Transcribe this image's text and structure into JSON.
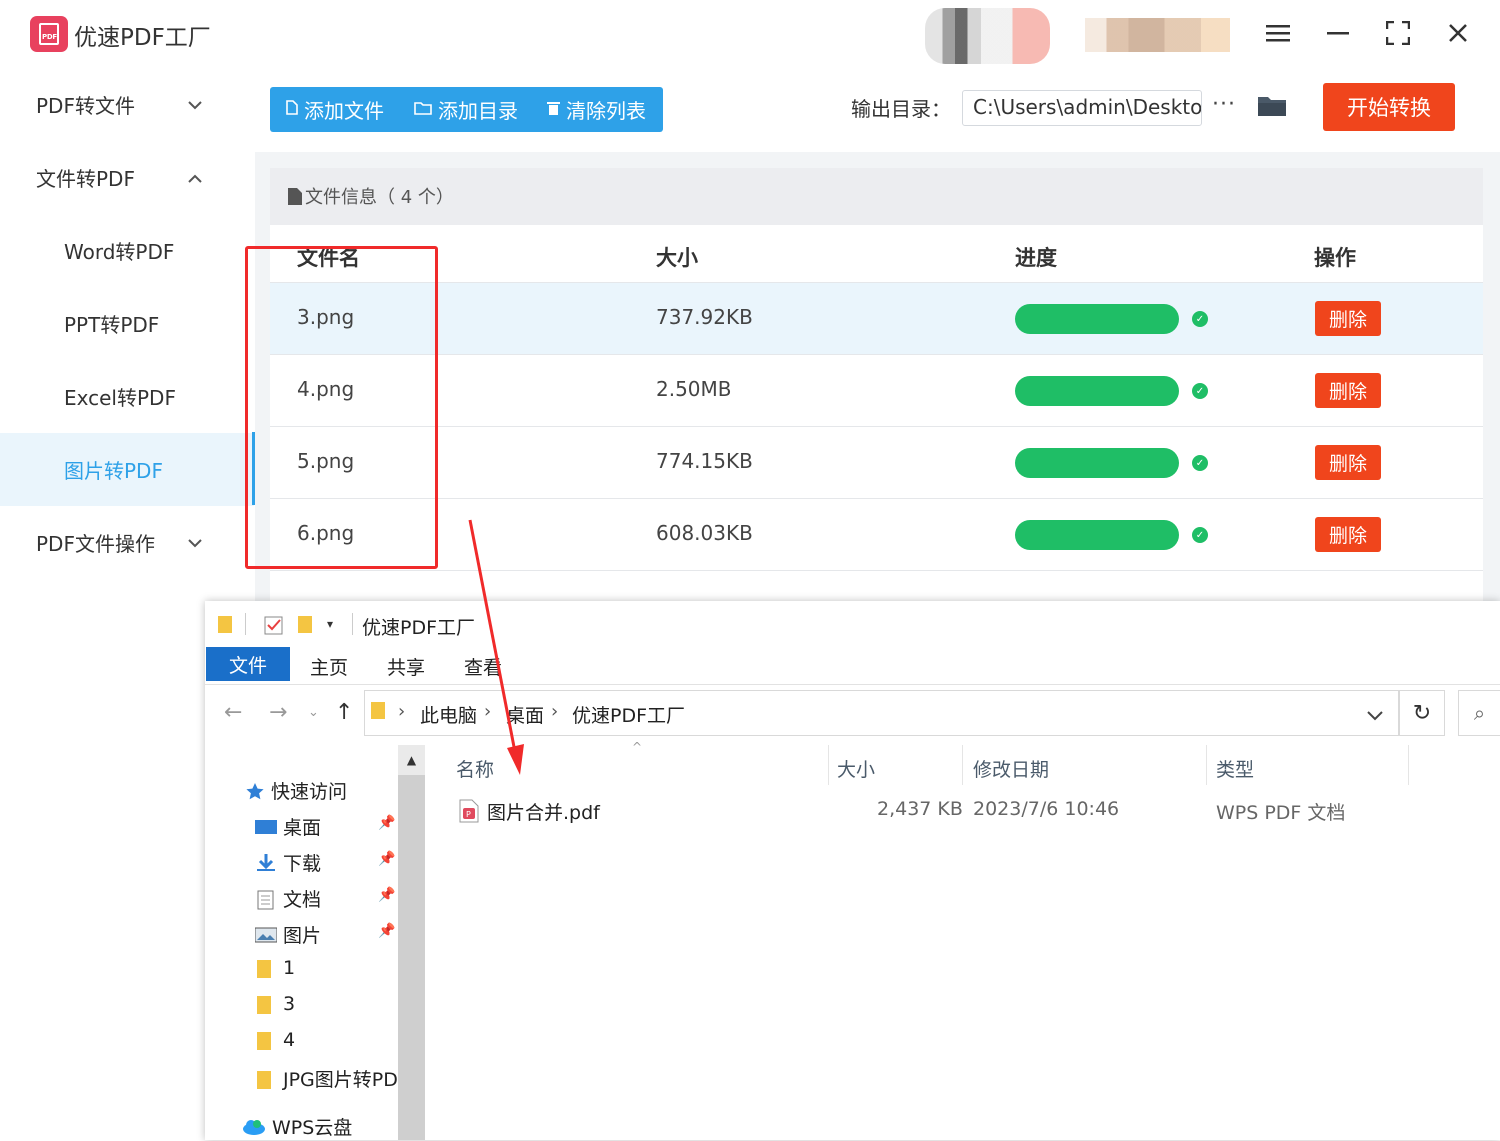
{
  "app": {
    "title": "优速PDF工厂",
    "logo_text": "PDF"
  },
  "window_controls": [
    "menu-icon",
    "minimize-icon",
    "fullscreen-icon",
    "close-icon"
  ],
  "sidebar": {
    "items": [
      {
        "label": "PDF转文件",
        "expanded": false
      },
      {
        "label": "文件转PDF",
        "expanded": true
      },
      {
        "label": "Word转PDF",
        "sub": true
      },
      {
        "label": "PPT转PDF",
        "sub": true
      },
      {
        "label": "Excel转PDF",
        "sub": true
      },
      {
        "label": "图片转PDF",
        "sub": true,
        "active": true
      },
      {
        "label": "PDF文件操作",
        "expanded": false
      }
    ]
  },
  "toolbar": {
    "add_file": "添加文件",
    "add_dir": "添加目录",
    "clear_list": "清除列表",
    "output_label": "输出目录：",
    "output_value": "C:\\Users\\admin\\Deskto",
    "more": "···",
    "start": "开始转换"
  },
  "file_panel": {
    "title": "文件信息（ 4 个）",
    "columns": [
      "文件名",
      "大小",
      "进度",
      "操作"
    ],
    "rows": [
      {
        "name": "3.png",
        "size": "737.92KB",
        "progress": 1.0,
        "action": "删除"
      },
      {
        "name": "4.png",
        "size": "2.50MB",
        "progress": 1.0,
        "action": "删除"
      },
      {
        "name": "5.png",
        "size": "774.15KB",
        "progress": 1.0,
        "action": "删除"
      },
      {
        "name": "6.png",
        "size": "608.03KB",
        "progress": 1.0,
        "action": "删除"
      }
    ]
  },
  "explorer": {
    "title": "优速PDF工厂",
    "ribbon": [
      "文件",
      "主页",
      "共享",
      "查看"
    ],
    "breadcrumb": [
      "此电脑",
      "桌面",
      "优速PDF工厂"
    ],
    "nav": [
      {
        "label": "快速访问",
        "icon": "star-icon"
      },
      {
        "label": "桌面",
        "icon": "desktop-icon",
        "pinned": true
      },
      {
        "label": "下载",
        "icon": "download-icon",
        "pinned": true
      },
      {
        "label": "文档",
        "icon": "document-icon",
        "pinned": true
      },
      {
        "label": "图片",
        "icon": "picture-icon",
        "pinned": true
      },
      {
        "label": "1",
        "icon": "folder-icon"
      },
      {
        "label": "3",
        "icon": "folder-icon"
      },
      {
        "label": "4",
        "icon": "folder-icon"
      },
      {
        "label": "JPG图片转PDF",
        "icon": "folder-icon"
      },
      {
        "label": "WPS云盘",
        "icon": "cloud-icon"
      }
    ],
    "columns": [
      "名称",
      "大小",
      "修改日期",
      "类型"
    ],
    "files": [
      {
        "name": "图片合并.pdf",
        "size": "2,437 KB",
        "date": "2023/7/6 10:46",
        "type": "WPS PDF 文档"
      }
    ]
  },
  "colors": {
    "accent": "#2ea1e8",
    "danger": "#f0451c",
    "success": "#1fbe66",
    "annotation": "#f02a2a"
  }
}
